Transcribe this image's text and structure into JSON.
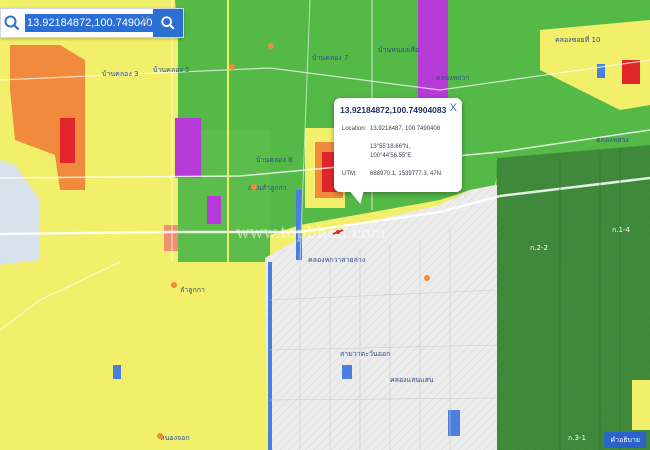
{
  "search": {
    "query": "13.92184872,100.74904083",
    "clear_label": "X",
    "search_icon": "search-icon"
  },
  "popup": {
    "title": "13.92184872,100.74904083",
    "close_label": "X",
    "location_label": "Location:",
    "location_value": "13.9218487, 100.7490408",
    "dms_lat": "13°55'18.66\"N,",
    "dms_lon": "100°44'56.55\"E",
    "utm_label": "UTM:",
    "utm_value": "688970.1, 1539777.3, 47N"
  },
  "watermark": "www.topbhan.com",
  "legend_button": "คำอธิบาย",
  "map_labels": [
    "บ้านคลอง 3",
    "บ้านคลอง 5",
    "บ้านคลอง 7",
    "บ้านหนองเสือ",
    "บ้านคลอง 8",
    "คลองหกวา",
    "คลองซอยที่ 10",
    "คลองหลวง",
    "ถนนลำลูกกา",
    "คลองหกวาสายล่าง",
    "ลำลูกกา",
    "สามวาตะวันออก",
    "คลองแสนแสบ",
    "หนองจอก",
    "ก.1-4",
    "ก.2-2",
    "ก.3-1"
  ],
  "colors": {
    "residential_yellow": "#f2ef6a",
    "agricultural_green": "#55b948",
    "dark_green": "#3f8a3a",
    "industrial_purple": "#b53ad6",
    "commercial_red": "#e1262b",
    "orange": "#f08a3c",
    "conservation_gray": "#e9e9e9",
    "search_blue": "#2c6fd1"
  }
}
